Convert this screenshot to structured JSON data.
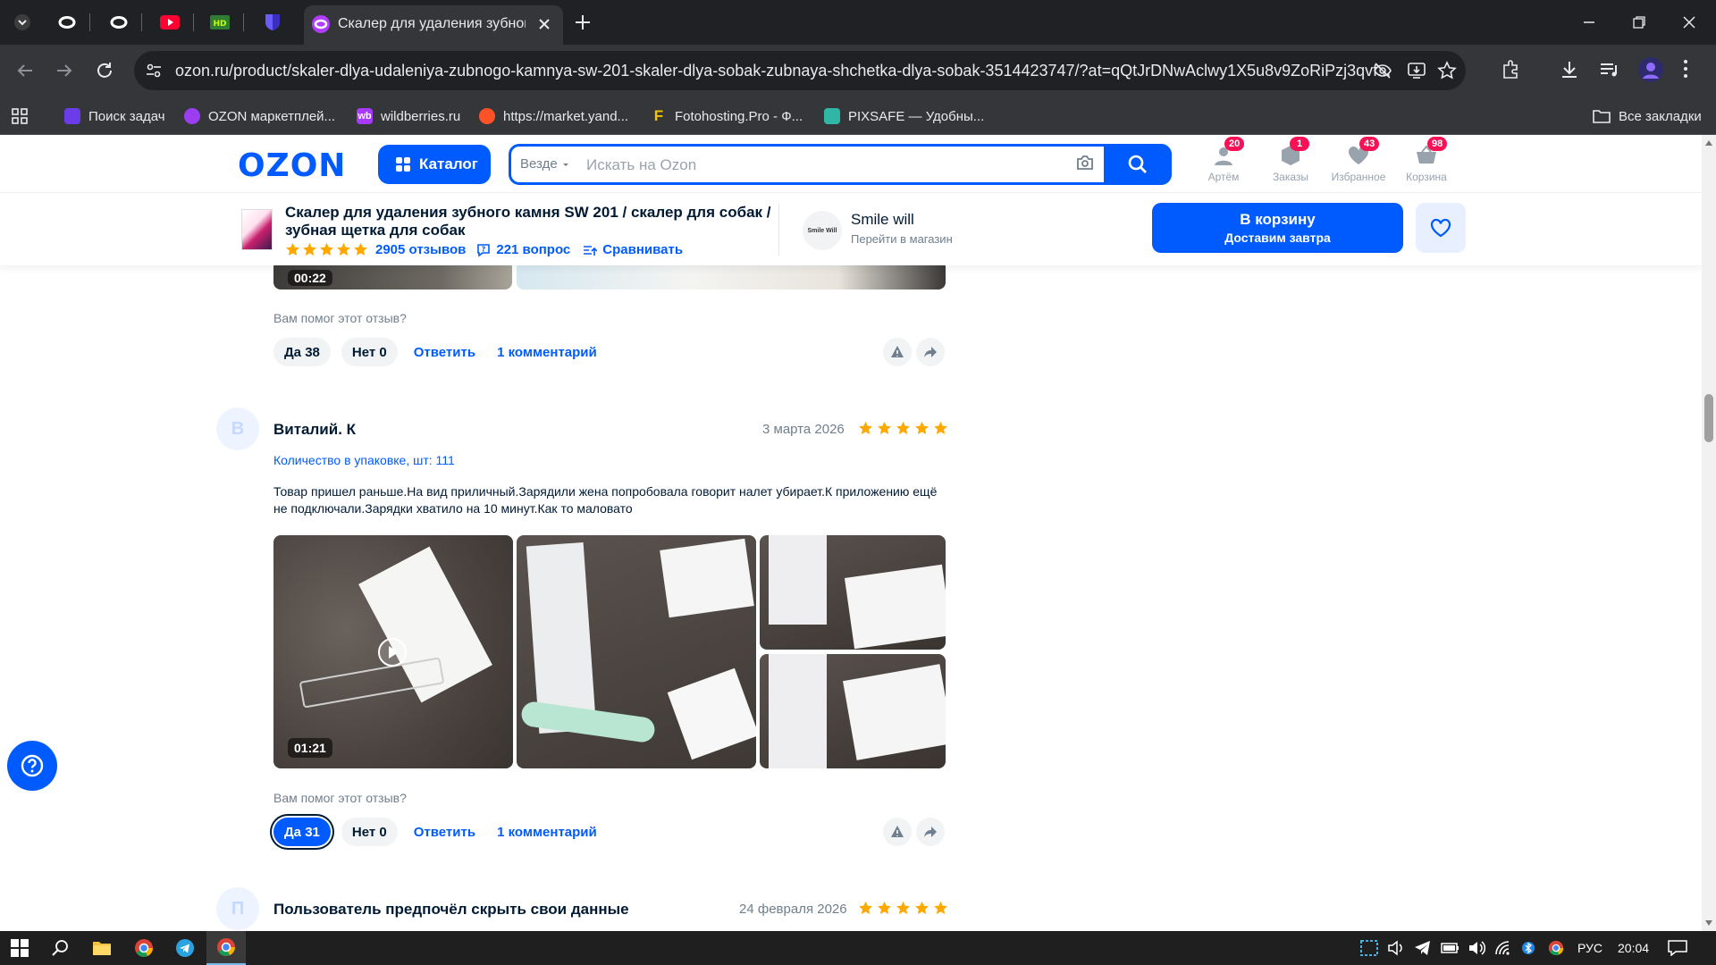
{
  "browser": {
    "active_tab_title": "Скалер для удаления зубного",
    "url": "ozon.ru/product/skaler-dlya-udaleniya-zubnogo-kamnya-sw-201-skaler-dlya-sobak-zubnaya-shchetka-dlya-sobak-3514423747/?at=qQtJrDNwAclwy1X5u8v9ZoRiPzj3qvf...",
    "bookmarks": [
      {
        "label": "Поиск задач",
        "icon": "brand-shield-icon",
        "color": "#6a3de8"
      },
      {
        "label": "OZON маркетплей...",
        "icon": "ozon-icon",
        "color": "#9b3df0"
      },
      {
        "label": "wildberries.ru",
        "icon": "wb-icon",
        "color": "#a73afd"
      },
      {
        "label": "https://market.yand...",
        "icon": "flame-icon",
        "color": "#ff5226"
      },
      {
        "label": "Fotohosting.Pro - Ф...",
        "icon": "f-icon",
        "color": "#f5c400"
      },
      {
        "label": "PIXSAFE — Удобны...",
        "icon": "shield-icon",
        "color": "#2fb6a4"
      }
    ],
    "all_bookmarks": "Все закладки"
  },
  "header": {
    "logo": "OZON",
    "catalog": "Каталог",
    "search_scope": "Везде",
    "search_placeholder": "Искать на Ozon",
    "items": [
      {
        "label": "Артём",
        "badge": "20"
      },
      {
        "label": "Заказы",
        "badge": "1"
      },
      {
        "label": "Избранное",
        "badge": "43"
      },
      {
        "label": "Корзина",
        "badge": "98"
      }
    ]
  },
  "product": {
    "title": "Скалер для удаления зубного камня SW 201 / скалер для собак / зубная щетка для собак",
    "reviews_count": "2905 отзывов",
    "questions": "221 вопрос",
    "compare": "Сравнивать",
    "rating": 5,
    "seller_name": "Smile will",
    "seller_logo_text": "Smile Will",
    "seller_link": "Перейти в магазин",
    "cart_line1": "В корзину",
    "cart_line2": "Доставим завтра"
  },
  "colors": {
    "brand": "#005bff",
    "star": "#ffa800",
    "badge": "#f91155"
  },
  "review_prev": {
    "duration": "00:22",
    "helpful": "Вам помог этот отзыв?",
    "yes": "Да 38",
    "no": "Нет 0",
    "reply": "Ответить",
    "comments": "1 комментарий"
  },
  "review_main": {
    "avatar": "В",
    "name": "Виталий. К",
    "date": "3 марта 2026",
    "rating": 5,
    "variant": "Количество в упаковке, шт: 111",
    "text": "Товар пришел раньше.На вид приличный.Зарядили жена попробовала говорит налет убирает.К приложению ещё не подключали.Зарядки хватило на 10 минут.Как то маловато",
    "duration": "01:21",
    "helpful": "Вам помог этот отзыв?",
    "yes": "Да 31",
    "no": "Нет 0",
    "reply": "Ответить",
    "comments": "1 комментарий"
  },
  "review_next": {
    "avatar": "П",
    "name": "Пользователь предпочёл скрыть свои данные",
    "date": "24 февраля 2026",
    "rating": 5
  },
  "taskbar": {
    "lang": "РУС",
    "time": "20:04"
  }
}
